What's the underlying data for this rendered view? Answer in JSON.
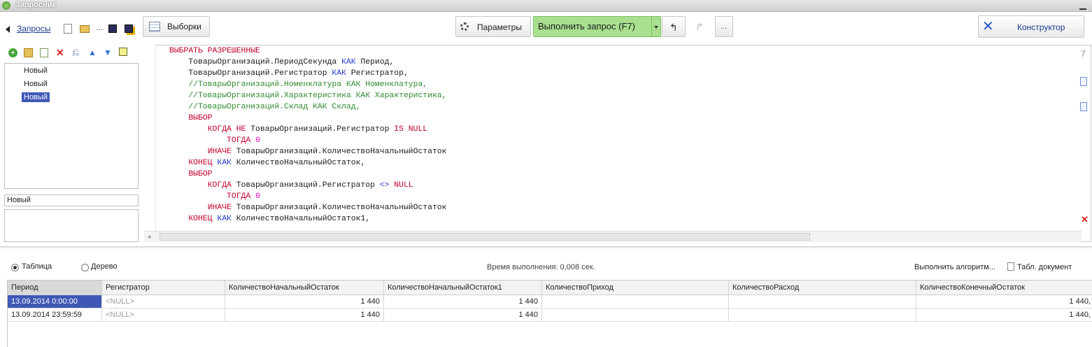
{
  "window": {
    "title": "Запросник"
  },
  "toolbar": {
    "back_link": "Запросы",
    "selections": "Выборки",
    "params": "Параметры",
    "execute": "Выполнить запрос (F7)",
    "more": "...",
    "constructor": "Конструктор"
  },
  "queries": {
    "items": [
      {
        "name": "Новый"
      },
      {
        "name": "Новый"
      },
      {
        "name": "Новый"
      }
    ],
    "name_value": "Новый"
  },
  "results": {
    "view_table": "Таблица",
    "view_tree": "Дерево",
    "exec_time": "Время выполнения: 0,008 сек.",
    "run_algorithm": "Выполнить алгоритм...",
    "spreadsheet": "Табл. документ",
    "columns": [
      "Период",
      "Регистратор",
      "КоличествоНачальныйОстаток",
      "КоличествоНачальныйОстаток1",
      "КоличествоПриход",
      "КоличествоРасход",
      "КоличествоКонечныйОстаток"
    ],
    "rows": [
      [
        "13.09.2014 0:00:00",
        "<NULL>",
        "1 440",
        "1 440",
        "",
        "",
        "1 440,"
      ],
      [
        "13.09.2014 23:59:59",
        "<NULL>",
        "1 440",
        "1 440",
        "",
        "",
        "1 440,"
      ]
    ]
  },
  "colors": {
    "selection": "#3f58b6",
    "execute_bg": "#a8e08f",
    "keyword": "#c0002b",
    "keyword_blue": "#1f38c9",
    "comment": "#2f8a2f"
  }
}
